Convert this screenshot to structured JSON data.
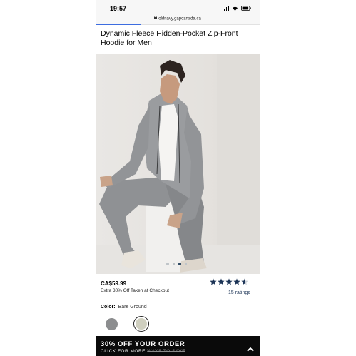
{
  "status_bar": {
    "time": "19:57"
  },
  "browser": {
    "url": "oldnavy.gapcanada.ca",
    "load_progress": 0.28
  },
  "product": {
    "title": "Dynamic Fleece Hidden-Pocket Zip-Front Hoodie for Men",
    "price": "CA$59.99",
    "promo": "Extra 30% Off Taken at Checkout",
    "rating": 4.5,
    "ratings_label": "15 ratings"
  },
  "gallery": {
    "image_count": 4,
    "active_index": 2
  },
  "color": {
    "label": "Color:",
    "selected": "Bare Ground",
    "swatches": [
      {
        "name": "grey",
        "color": "#8c8d8f"
      },
      {
        "name": "Bare Ground",
        "color": "#cfcfbf"
      }
    ]
  },
  "banner": {
    "headline": "30% OFF YOUR ORDER",
    "cta_prefix": "CLICK FOR MORE",
    "cta_struck": "WAYS TO SAVE"
  },
  "colors": {
    "star": "#1d3557",
    "banner_bg": "#0a0a0a",
    "progress": "#3d6de0"
  }
}
